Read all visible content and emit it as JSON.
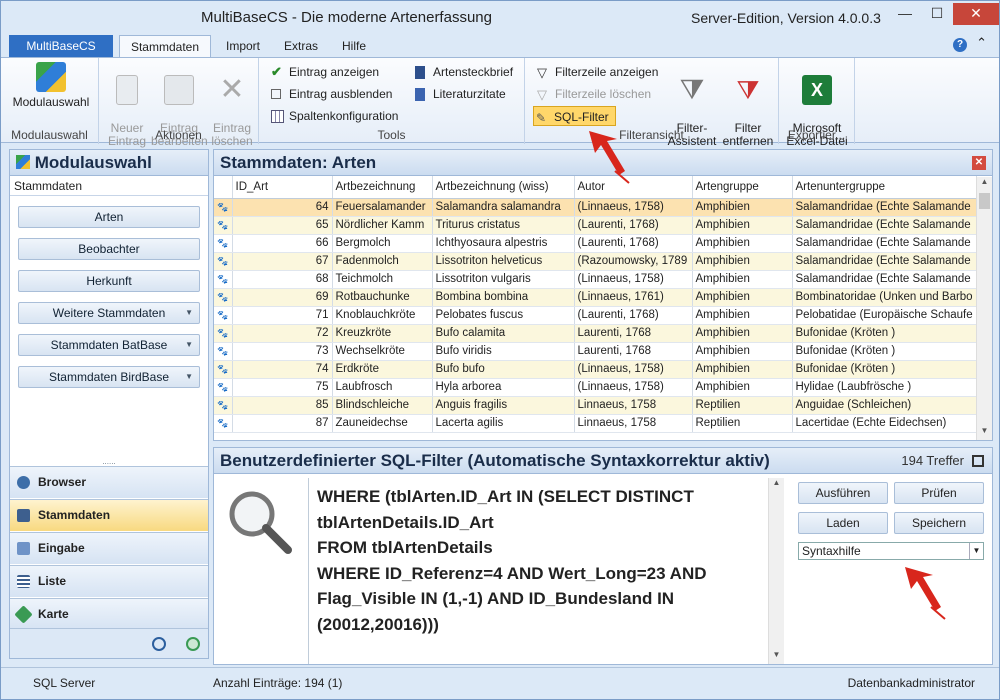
{
  "window": {
    "title": "MultiBaseCS - Die moderne Artenerfassung",
    "edition": "Server-Edition, Version 4.0.0.3",
    "minimize": "—",
    "maximize": "☐",
    "close": "✕"
  },
  "ribbon_tabs": {
    "app": "MultiBaseCS",
    "tabs": [
      "Stammdaten",
      "Import",
      "Extras",
      "Hilfe"
    ],
    "help": "?",
    "collapse": "⌃"
  },
  "ribbon": {
    "modul": {
      "button": "Modulauswahl",
      "group": "Modulauswahl"
    },
    "aktionen": {
      "neu": "Neuer\nEintrag",
      "bearbeiten": "Eintrag\nbearbeiten",
      "loeschen": "Eintrag\nlöschen",
      "group": "Aktionen"
    },
    "tools": {
      "anzeigen": "Eintrag anzeigen",
      "ausblenden": "Eintrag ausblenden",
      "spalten": "Spaltenkonfiguration",
      "steckbrief": "Artensteckbrief",
      "literatur": "Literaturzitate",
      "group": "Tools"
    },
    "filter": {
      "zeile_anzeigen": "Filterzeile anzeigen",
      "zeile_loeschen": "Filterzeile löschen",
      "sql": "SQL-Filter",
      "assistent": "Filter-\nAssistent",
      "entfernen": "Filter\nentfernen",
      "group": "Filteransicht"
    },
    "export": {
      "excel": "Microsoft\nExcel-Datei",
      "group": "Exportier..."
    }
  },
  "left_panel": {
    "title": "Modulauswahl",
    "subtitle": "Stammdaten",
    "buttons": [
      "Arten",
      "Beobachter",
      "Herkunft",
      "Weitere Stammdaten",
      "Stammdaten BatBase",
      "Stammdaten BirdBase"
    ],
    "separator": "......",
    "nav": [
      "Browser",
      "Stammdaten",
      "Eingabe",
      "Liste",
      "Karte"
    ]
  },
  "main_panel": {
    "title": "Stammdaten: Arten",
    "columns": [
      "ID_Art",
      "Artbezeichnung",
      "Artbezeichnung (wiss)",
      "Autor",
      "Artengruppe",
      "Artenuntergruppe"
    ],
    "rows": [
      [
        "64",
        "Feuersalamander",
        "Salamandra salamandra",
        "(Linnaeus, 1758)",
        "Amphibien",
        "Salamandridae (Echte Salamande"
      ],
      [
        "65",
        "Nördlicher Kamm",
        "Triturus cristatus",
        "(Laurenti, 1768)",
        "Amphibien",
        "Salamandridae (Echte Salamande"
      ],
      [
        "66",
        "Bergmolch",
        "Ichthyosaura alpestris",
        "(Laurenti, 1768)",
        "Amphibien",
        "Salamandridae (Echte Salamande"
      ],
      [
        "67",
        "Fadenmolch",
        "Lissotriton helveticus",
        "(Razoumowsky, 1789",
        "Amphibien",
        "Salamandridae (Echte Salamande"
      ],
      [
        "68",
        "Teichmolch",
        "Lissotriton vulgaris",
        "(Linnaeus, 1758)",
        "Amphibien",
        "Salamandridae (Echte Salamande"
      ],
      [
        "69",
        "Rotbauchunke",
        "Bombina bombina",
        "(Linnaeus, 1761)",
        "Amphibien",
        "Bombinatoridae (Unken und Barbo"
      ],
      [
        "71",
        "Knoblauchkröte",
        "Pelobates fuscus",
        "(Laurenti, 1768)",
        "Amphibien",
        "Pelobatidae (Europäische Schaufe"
      ],
      [
        "72",
        "Kreuzkröte",
        "Bufo calamita",
        "Laurenti, 1768",
        "Amphibien",
        "Bufonidae (Kröten )"
      ],
      [
        "73",
        "Wechselkröte",
        "Bufo viridis",
        "Laurenti, 1768",
        "Amphibien",
        "Bufonidae (Kröten )"
      ],
      [
        "74",
        "Erdkröte",
        "Bufo bufo",
        "(Linnaeus, 1758)",
        "Amphibien",
        "Bufonidae (Kröten )"
      ],
      [
        "75",
        "Laubfrosch",
        "Hyla arborea",
        "(Linnaeus, 1758)",
        "Amphibien",
        "Hylidae (Laubfrösche )"
      ],
      [
        "85",
        "Blindschleiche",
        "Anguis fragilis",
        "Linnaeus, 1758",
        "Reptilien",
        "Anguidae (Schleichen)"
      ],
      [
        "87",
        "Zauneidechse",
        "Lacerta agilis",
        "Linnaeus, 1758",
        "Reptilien",
        "Lacertidae (Echte Eidechsen)"
      ]
    ]
  },
  "sql_panel": {
    "title": "Benutzerdefinierter SQL-Filter (Automatische Syntaxkorrektur aktiv)",
    "hits": "194 Treffer",
    "query": "WHERE (tblArten.ID_Art IN (SELECT DISTINCT\ntblArtenDetails.ID_Art\nFROM tblArtenDetails\nWHERE ID_Referenz=4 AND Wert_Long=23 AND\nFlag_Visible IN (1,-1) AND ID_Bundesland IN\n(20012,20016)))",
    "buttons": {
      "ausfuehren": "Ausführen",
      "pruefen": "Prüfen",
      "laden": "Laden",
      "speichern": "Speichern"
    },
    "syntax": "Syntaxhilfe"
  },
  "statusbar": {
    "server": "SQL Server",
    "count": "Anzahl Einträge: 194 (1)",
    "user": "Datenbankadministrator"
  },
  "colors": {
    "accent": "#2f6fc4",
    "highlight": "#ffd76a",
    "row_alt": "#fbf7dd",
    "row_sel": "#fce2b0",
    "arrow": "#d8261c"
  }
}
